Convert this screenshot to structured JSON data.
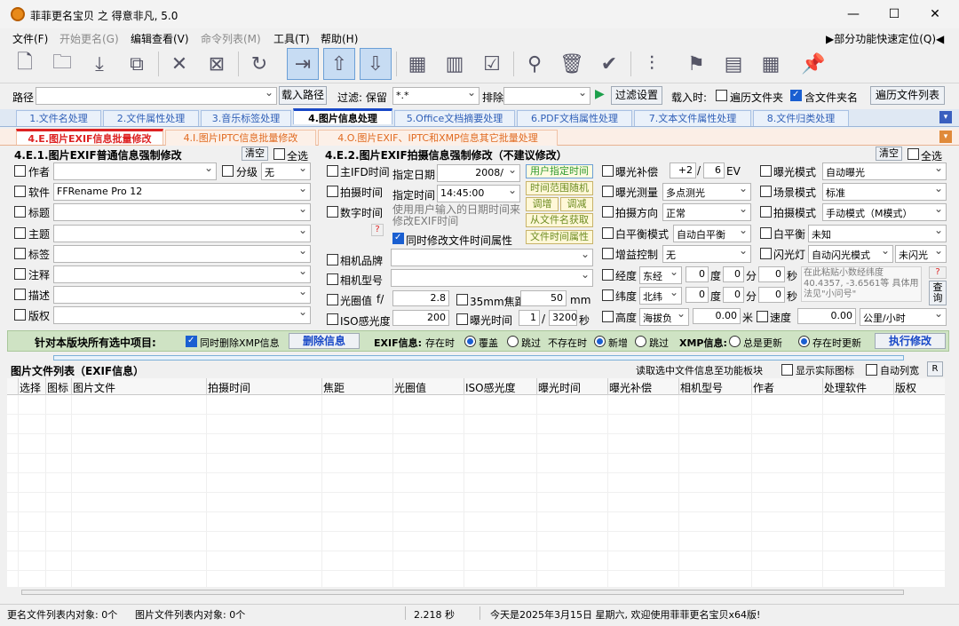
{
  "window": {
    "title": "菲菲更名宝贝 之 得意非凡, 5.0",
    "min": "—",
    "max": "☐",
    "close": "✕"
  },
  "menu": {
    "file": "文件(F)",
    "start": "开始更名(G)",
    "edit": "编辑查看(V)",
    "cmdlist": "命令列表(M)",
    "tools": "工具(T)",
    "help": "帮助(H)",
    "quick": "▶部分功能快速定位(Q)◀"
  },
  "pathrow": {
    "path_label": "路径",
    "load_btn": "载入路径",
    "filter_label": "过滤: 保留",
    "filter_value": "*.*",
    "exclude_label": "排除",
    "filter_settings_btn": "过滤设置",
    "load_when": "载入时:",
    "traverse_label": "遍历文件夹",
    "include_label": "含文件夹名",
    "traverse_list_btn": "遍历文件列表"
  },
  "tabs1": [
    "1.文件名处理",
    "2.文件属性处理",
    "3.音乐标签处理",
    "4.图片信息处理",
    "5.Office文档摘要处理",
    "6.PDF文档属性处理",
    "7.文本文件属性处理",
    "8.文件归类处理"
  ],
  "tabs2": [
    "4.E.图片EXIF信息批量修改",
    "4.I.图片IPTC信息批量修改",
    "4.O.图片EXIF、IPTC和XMP信息其它批量处理"
  ],
  "left": {
    "title": "4.E.1.图片EXIF普通信息强制修改",
    "clear": "清空",
    "select_all": "全选",
    "fields": [
      "作者",
      "软件",
      "标题",
      "主题",
      "标签",
      "注释",
      "描述",
      "版权"
    ],
    "software_value": "FFRename Pro 12",
    "grade_label": "分级",
    "grade_value": "无"
  },
  "mid": {
    "title": "4.E.2.图片EXIF拍摄信息强制修改（不建议修改）",
    "main_ifd": "主IFD时间",
    "shoot_time": "拍摄时间",
    "digital_time": "数字时间",
    "spec_date_label": "指定日期",
    "spec_date_value": "2008/",
    "spec_time_label": "指定时间",
    "spec_time_value": "14:45:00",
    "hint": "使用用户输入的日期时间来修改EXIF时间",
    "user_time_btn": "用户指定时间",
    "random_btn": "时间范围随机",
    "adj_up": "调增",
    "adj_down": "调减",
    "from_name_btn": "从文件名获取",
    "file_time_btn": "文件时间属性",
    "sync_label": "同时修改文件时间属性",
    "q": "?",
    "camera_brand": "相机品牌",
    "camera_model": "相机型号",
    "aperture_label": "光圈值",
    "aperture_f": "f/",
    "aperture_value": "2.8",
    "focal_label": "35mm焦距",
    "focal_value": "50",
    "focal_unit": "mm",
    "iso_label": "ISO感光度",
    "iso_value": "200",
    "exposure_time_label": "曝光时间",
    "exposure_time_num": "1",
    "exposure_time_slash": "/",
    "exposure_time_den": "3200",
    "exposure_time_unit": "秒"
  },
  "right": {
    "clear": "清空",
    "select_all": "全选",
    "exp_comp": "曝光补偿",
    "exp_comp_val": "+2",
    "exp_comp_slash": "/",
    "exp_comp_den": "6",
    "exp_comp_unit": "EV",
    "exp_mode": "曝光模式",
    "exp_mode_val": "自动曝光",
    "metering": "曝光测量",
    "metering_val": "多点测光",
    "scene": "场景模式",
    "scene_val": "标准",
    "orientation": "拍摄方向",
    "orientation_val": "正常",
    "shoot_mode": "拍摄模式",
    "shoot_mode_val": "手动模式（M模式）",
    "wb_mode": "白平衡模式",
    "wb_mode_val": "自动白平衡",
    "wb": "白平衡",
    "wb_val": "未知",
    "gain": "增益控制",
    "gain_val": "无",
    "flash": "闪光灯",
    "flash_val": "自动闪光模式",
    "flash_val2": "未闪光",
    "lon": "经度",
    "lon_dir": "东经",
    "lat": "纬度",
    "lat_dir": "北纬",
    "alt": "高度",
    "alt_val": "海拔负",
    "alt_num": "0.00",
    "alt_unit": "米",
    "deg": "度",
    "min": "分",
    "sec": "秒",
    "zero": "0",
    "speed": "速度",
    "speed_val": "0.00",
    "speed_unit": "公里/小时",
    "gps_hint": "在此粘贴小数经纬度 40.4357, -3.6561等 具体用法见\"小问号\"",
    "gps_q": "?",
    "query_btn": "查询"
  },
  "greenbar": {
    "title": "针对本版块所有选中项目:",
    "xmp_del": "同时删除XMP信息",
    "del_btn": "删除信息",
    "exif_label": "EXIF信息:",
    "exists": "存在时",
    "overwrite": "覆盖",
    "skip": "跳过",
    "not_exists": "不存在时",
    "add": "新增",
    "skip2": "跳过",
    "xmp_label": "XMP信息:",
    "always": "总是更新",
    "when_exists": "存在时更新",
    "exec_btn": "执行修改"
  },
  "list": {
    "title": "图片文件列表（EXIF信息）",
    "read_sel": "读取选中文件信息至功能板块",
    "show_icon": "显示实际图标",
    "auto_width": "自动列宽",
    "r": "R",
    "columns": [
      "选择",
      "图标",
      "图片文件",
      "拍摄时间",
      "焦距",
      "光圈值",
      "ISO感光度",
      "曝光时间",
      "曝光补偿",
      "相机型号",
      "作者",
      "处理软件",
      "版权"
    ]
  },
  "status": {
    "rename_count": "更名文件列表内对象: 0个",
    "image_count": "图片文件列表内对象: 0个",
    "time": "2.218 秒",
    "welcome": "今天是2025年3月15日 星期六, 欢迎使用菲菲更名宝贝x64版!"
  },
  "colors": {
    "accent": "#1848c7",
    "tab2_active": "#d22222",
    "green_bar": "#cfe3c4"
  }
}
